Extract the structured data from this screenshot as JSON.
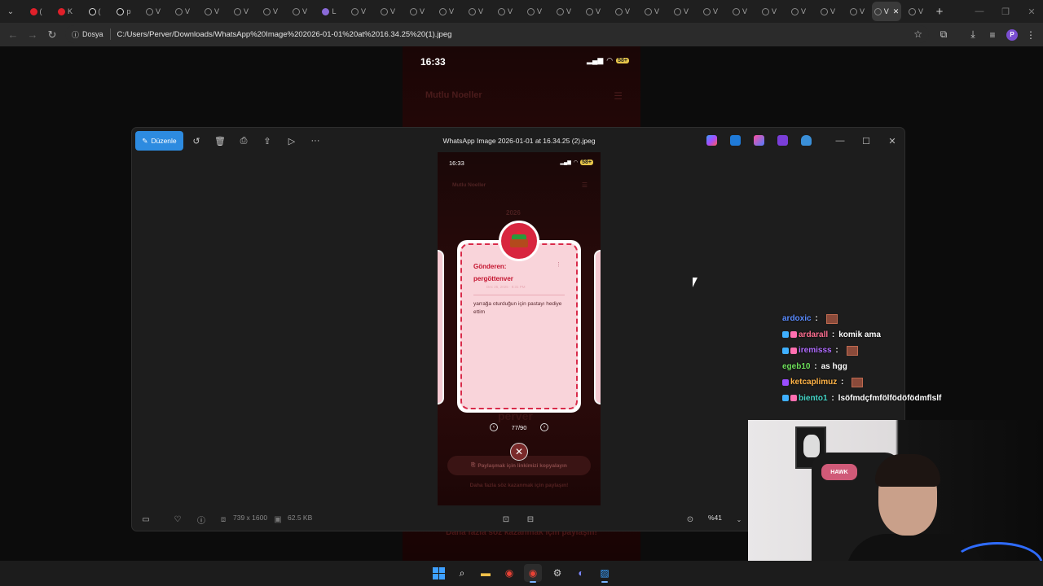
{
  "browser": {
    "tabs": [
      {
        "icon": "youtube-icon",
        "label": "("
      },
      {
        "icon": "youtube-icon",
        "label": "K"
      },
      {
        "icon": "tiktok-icon",
        "label": "("
      },
      {
        "icon": "tiktok-icon",
        "label": "p"
      },
      {
        "icon": "globe-icon",
        "label": "V"
      },
      {
        "icon": "globe-icon",
        "label": "V"
      },
      {
        "icon": "globe-icon",
        "label": "V"
      },
      {
        "icon": "globe-icon",
        "label": "V"
      },
      {
        "icon": "globe-icon",
        "label": "V"
      },
      {
        "icon": "globe-icon",
        "label": "V"
      },
      {
        "icon": "feather-icon",
        "label": "L"
      },
      {
        "icon": "globe-icon",
        "label": "V"
      },
      {
        "icon": "globe-icon",
        "label": "V"
      },
      {
        "icon": "globe-icon",
        "label": "V"
      },
      {
        "icon": "globe-icon",
        "label": "V"
      },
      {
        "icon": "globe-icon",
        "label": "V"
      },
      {
        "icon": "globe-icon",
        "label": "V"
      },
      {
        "icon": "globe-icon",
        "label": "V"
      },
      {
        "icon": "globe-icon",
        "label": "V"
      },
      {
        "icon": "globe-icon",
        "label": "V"
      },
      {
        "icon": "globe-icon",
        "label": "V"
      },
      {
        "icon": "globe-icon",
        "label": "V"
      },
      {
        "icon": "globe-icon",
        "label": "V"
      },
      {
        "icon": "globe-icon",
        "label": "V"
      },
      {
        "icon": "globe-icon",
        "label": "V"
      },
      {
        "icon": "globe-icon",
        "label": "V"
      },
      {
        "icon": "globe-icon",
        "label": "V"
      },
      {
        "icon": "globe-icon",
        "label": "V"
      },
      {
        "icon": "globe-icon",
        "label": "V"
      },
      {
        "icon": "globe-icon",
        "label": "V"
      },
      {
        "icon": "globe-icon",
        "label": "V"
      }
    ],
    "active_tab_close": "✕",
    "new_tab": "+",
    "address": {
      "chip_label": "Dosya",
      "url": "C:/Users/Perver/Downloads/WhatsApp%20Image%202026-01-01%20at%2016.34.25%20(1).jpeg"
    },
    "profile_initial": "P"
  },
  "background_image": {
    "time": "16:33",
    "battery": "58+",
    "title": "Mutlu Noeller",
    "bottom_text": "Daha fazla söz kazanmak için paylaşın!"
  },
  "photos": {
    "edit_label": "Düzenle",
    "file_title": "WhatsApp Image 2026-01-01 at 16.34.25 (2).jpeg",
    "dimensions": "739 x 1600",
    "file_size": "62.5 KB",
    "zoom": "%41",
    "phone": {
      "time": "16:33",
      "battery": "58+",
      "header": "Mutlu Noeller",
      "year": "2026",
      "card": {
        "sender_label": "Gönderen:",
        "sender_name": "pergöttenver",
        "date": "Dec 25, 2025 · 8:31 PM",
        "message": "yarrağa oturduğun için pastayı hediye ettim"
      },
      "ghost_name": "perver",
      "pager": "77/90",
      "share_label": "Paylaşmak için linkimizi kopyalayın",
      "more_text": "Daha fazla söz kazanmak için paylaşın!"
    }
  },
  "chat": [
    {
      "user": "ardoxic",
      "color": "#5b8cff",
      "message": "",
      "emote": true,
      "badges": []
    },
    {
      "user": "ardarall",
      "color": "#ff6f91",
      "message": "komik ama",
      "emote": false,
      "badges": [
        "#3fb0ff",
        "#ff6fb0"
      ]
    },
    {
      "user": "iremisss",
      "color": "#b06cff",
      "message": "",
      "emote": true,
      "badges": [
        "#3fb0ff",
        "#ff6fb0"
      ]
    },
    {
      "user": "egeb10",
      "color": "#6ddf5a",
      "message": "as hgg",
      "emote": false,
      "badges": []
    },
    {
      "user": "ketcaplimuz",
      "color": "#ffb347",
      "message": "",
      "emote": true,
      "badges": [
        "#9a4dff"
      ]
    },
    {
      "user": "biento1",
      "color": "#45d6c8",
      "message": "lsöfmdçfmfölfödöfödmflslf",
      "emote": false,
      "badges": [
        "#3fb0ff",
        "#ff6fb0"
      ]
    }
  ],
  "webcam": {
    "chair_logo": "HAWK"
  },
  "colors": {
    "accent": "#2d8be0",
    "card_red": "#d92b4a",
    "card_pink": "#f9d4da"
  }
}
